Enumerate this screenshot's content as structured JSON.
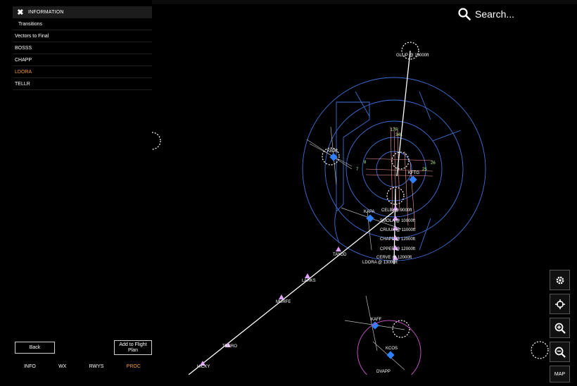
{
  "panel": {
    "header_title": "INFORMATION",
    "items": [
      {
        "label": "Transitions",
        "indented": true,
        "active": false
      },
      {
        "label": "Vectors to Final",
        "indented": false,
        "active": false
      },
      {
        "label": "BOSSS",
        "indented": false,
        "active": false
      },
      {
        "label": "CHAPP",
        "indented": false,
        "active": false
      },
      {
        "label": "LDORA",
        "indented": false,
        "active": true
      },
      {
        "label": "TELLR",
        "indented": false,
        "active": false
      }
    ],
    "back_label": "Back",
    "add_label": "Add to Flight Plan",
    "tabs": [
      {
        "label": "INFO",
        "active": false
      },
      {
        "label": "WX",
        "active": false
      },
      {
        "label": "RWYS",
        "active": false
      },
      {
        "label": "PROC",
        "active": true
      }
    ]
  },
  "search": {
    "label": "Search..."
  },
  "toolbar": {
    "map_label": "MAP"
  },
  "map": {
    "airports": [
      "KBJC",
      "KDEN",
      "KFTG",
      "KAPA",
      "KAFF",
      "KCOS",
      "KBKF",
      "KFLY"
    ],
    "fixes": [
      "GLLIP @ 19000ft",
      "CELBI @ 9000ft",
      "SMOLA @ 10000ft",
      "CRUUP @ 11000ft",
      "CHAPP @ 12000ft",
      "CPPER @ 12000ft",
      "CERVE @ 12000ft",
      "LDORA @ 13000ft",
      "TAYDD",
      "LARKS",
      "MURFE",
      "TERRO",
      "HICKY",
      "DVAPP",
      "PEZZE"
    ],
    "runway_numbers": [
      "34L",
      "26",
      "25",
      "8",
      "7",
      "17R"
    ],
    "colors": {
      "route": "#ffffff",
      "airspace": "#3f6fd6",
      "fix": "#e0a0ff",
      "airport": "#2f7fff",
      "runway": "#ff8f8f",
      "accent": "#f39a3c"
    }
  }
}
